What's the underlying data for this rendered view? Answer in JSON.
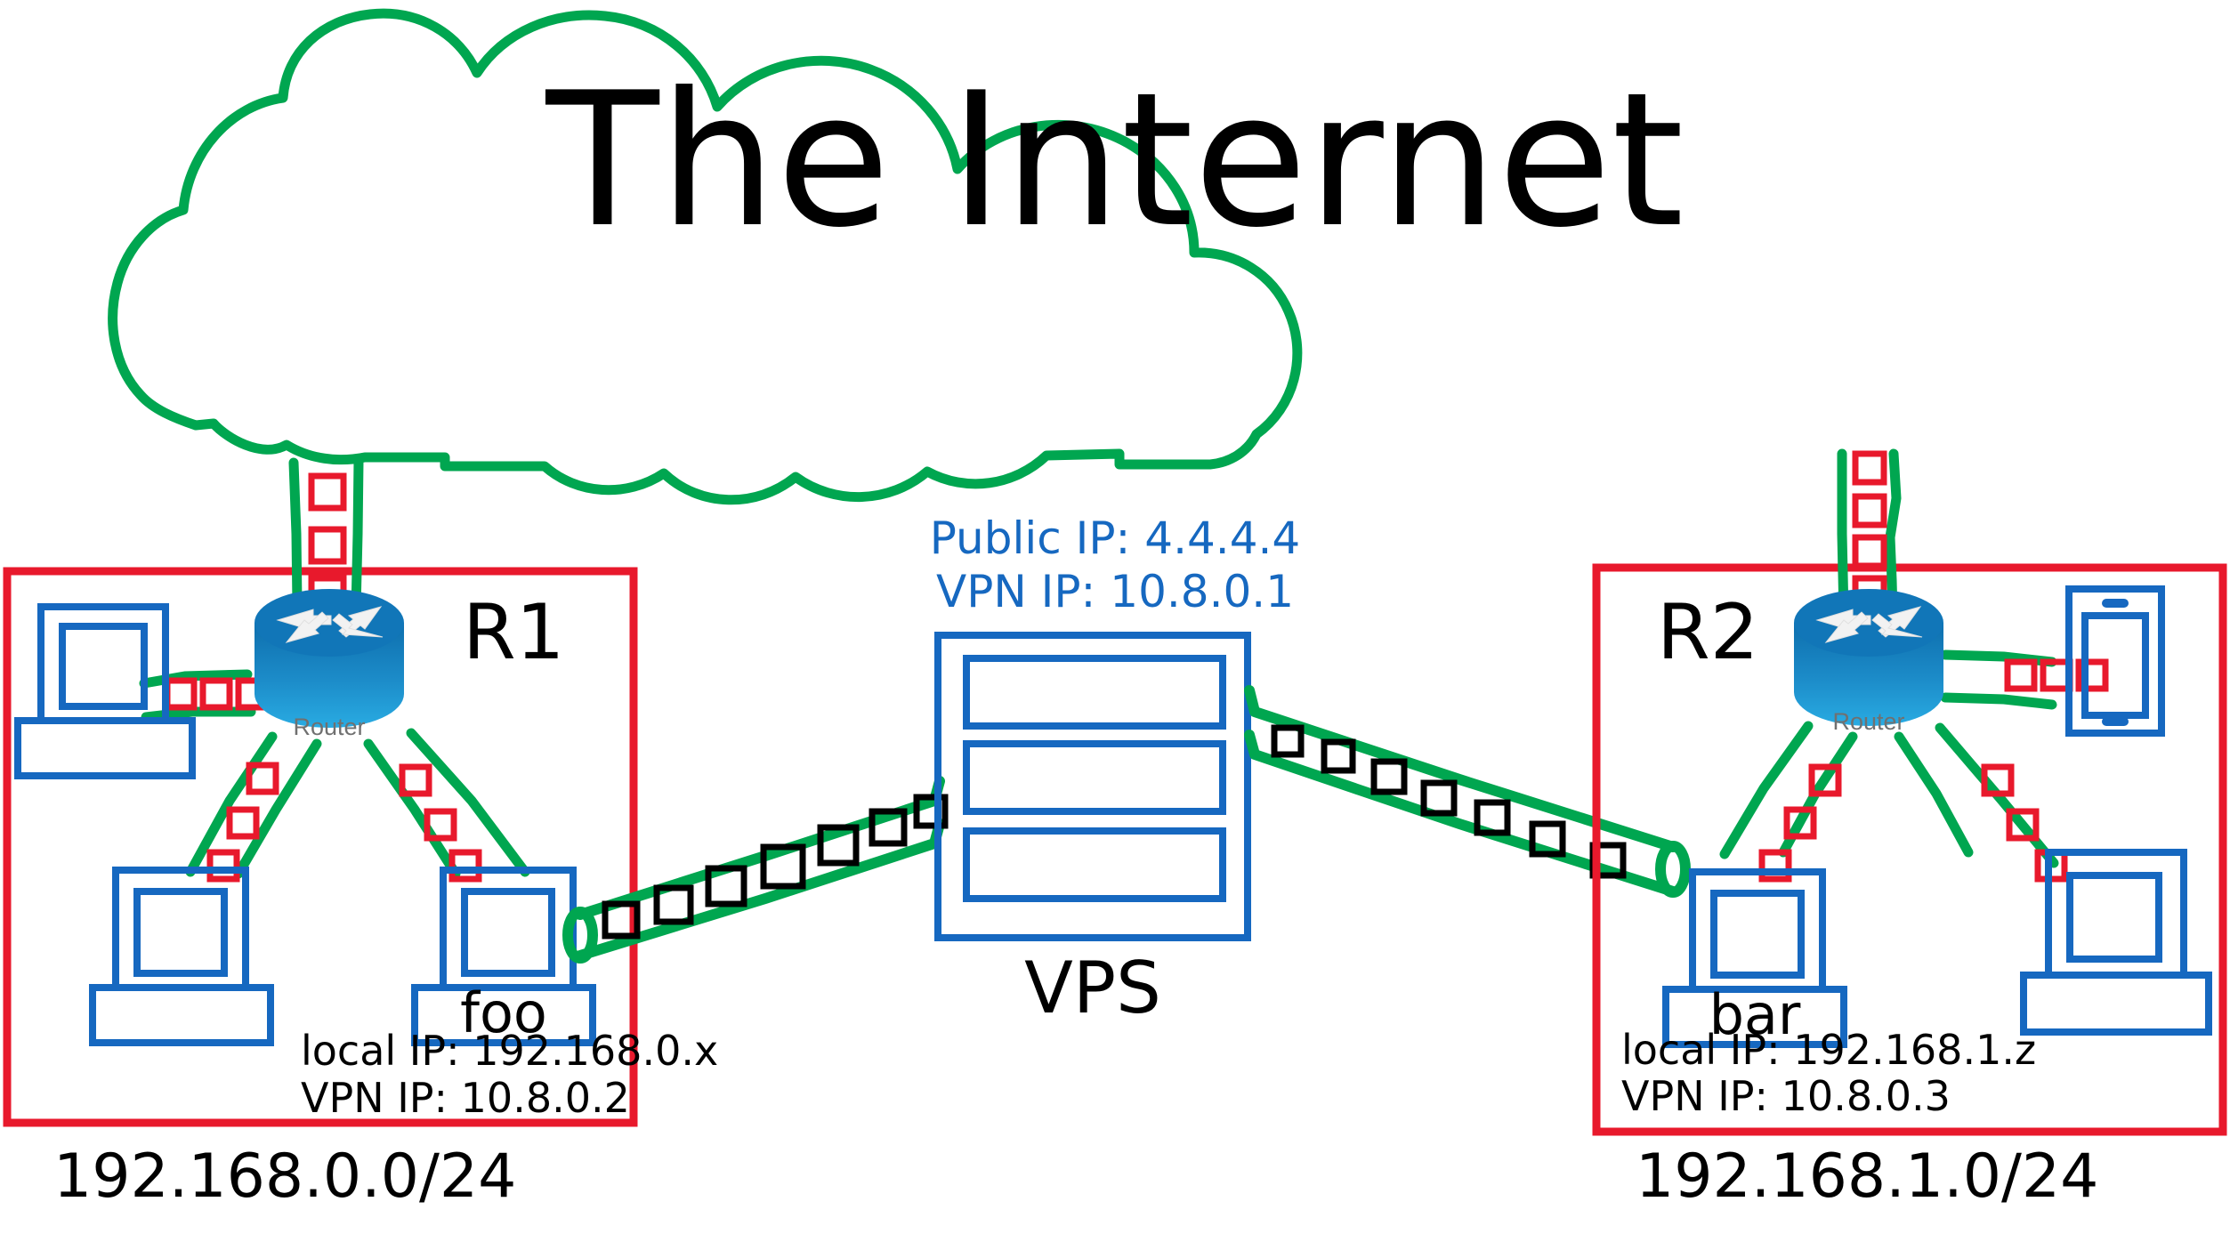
{
  "diagram": {
    "title": "The Internet",
    "cloud": {
      "label": "The Internet",
      "color": "#00A650"
    },
    "colors": {
      "green": "#00A650",
      "red": "#E8192C",
      "blue": "#1668C0",
      "black": "#000000",
      "router_blue_dark": "#0E6FAE",
      "router_blue_light": "#29ABE2",
      "gray": "#707070"
    }
  },
  "left_site": {
    "subnet_label": "192.168.0.0/24",
    "router": {
      "name": "R1",
      "icon_label": "Router",
      "icon": "router-icon"
    },
    "host": {
      "name": "foo",
      "local_ip_label": "local IP: 192.168.0.x",
      "vpn_ip_label": "VPN IP: 10.8.0.2"
    },
    "devices": [
      "desktop-computer",
      "desktop-computer",
      "desktop-computer-foo"
    ]
  },
  "right_site": {
    "subnet_label": "192.168.1.0/24",
    "router": {
      "name": "R2",
      "icon_label": "Router",
      "icon": "router-icon"
    },
    "host": {
      "name": "bar",
      "local_ip_label": "local IP: 192.168.1.z",
      "vpn_ip_label": "VPN IP: 10.8.0.3"
    },
    "devices": [
      "tablet-device",
      "desktop-computer-bar",
      "desktop-computer"
    ]
  },
  "vps": {
    "name": "VPS",
    "public_ip_label": "Public IP: 4.4.4.4",
    "vpn_ip_label": "VPN IP: 10.8.0.1",
    "icon": "server-rack-icon",
    "slots": 3
  },
  "links": {
    "uplink_left": {
      "from": "R1",
      "to": "The Internet",
      "packet_color": "#E8192C",
      "packets": 3
    },
    "uplink_right": {
      "from": "R2",
      "to": "The Internet",
      "packet_color": "#E8192C",
      "packets": 5
    },
    "tunnel_left": {
      "from": "foo",
      "to": "VPS",
      "packet_color": "#000000",
      "packets": 7
    },
    "tunnel_right": {
      "from": "VPS",
      "to": "bar",
      "packet_color": "#000000",
      "packets": 7
    }
  }
}
